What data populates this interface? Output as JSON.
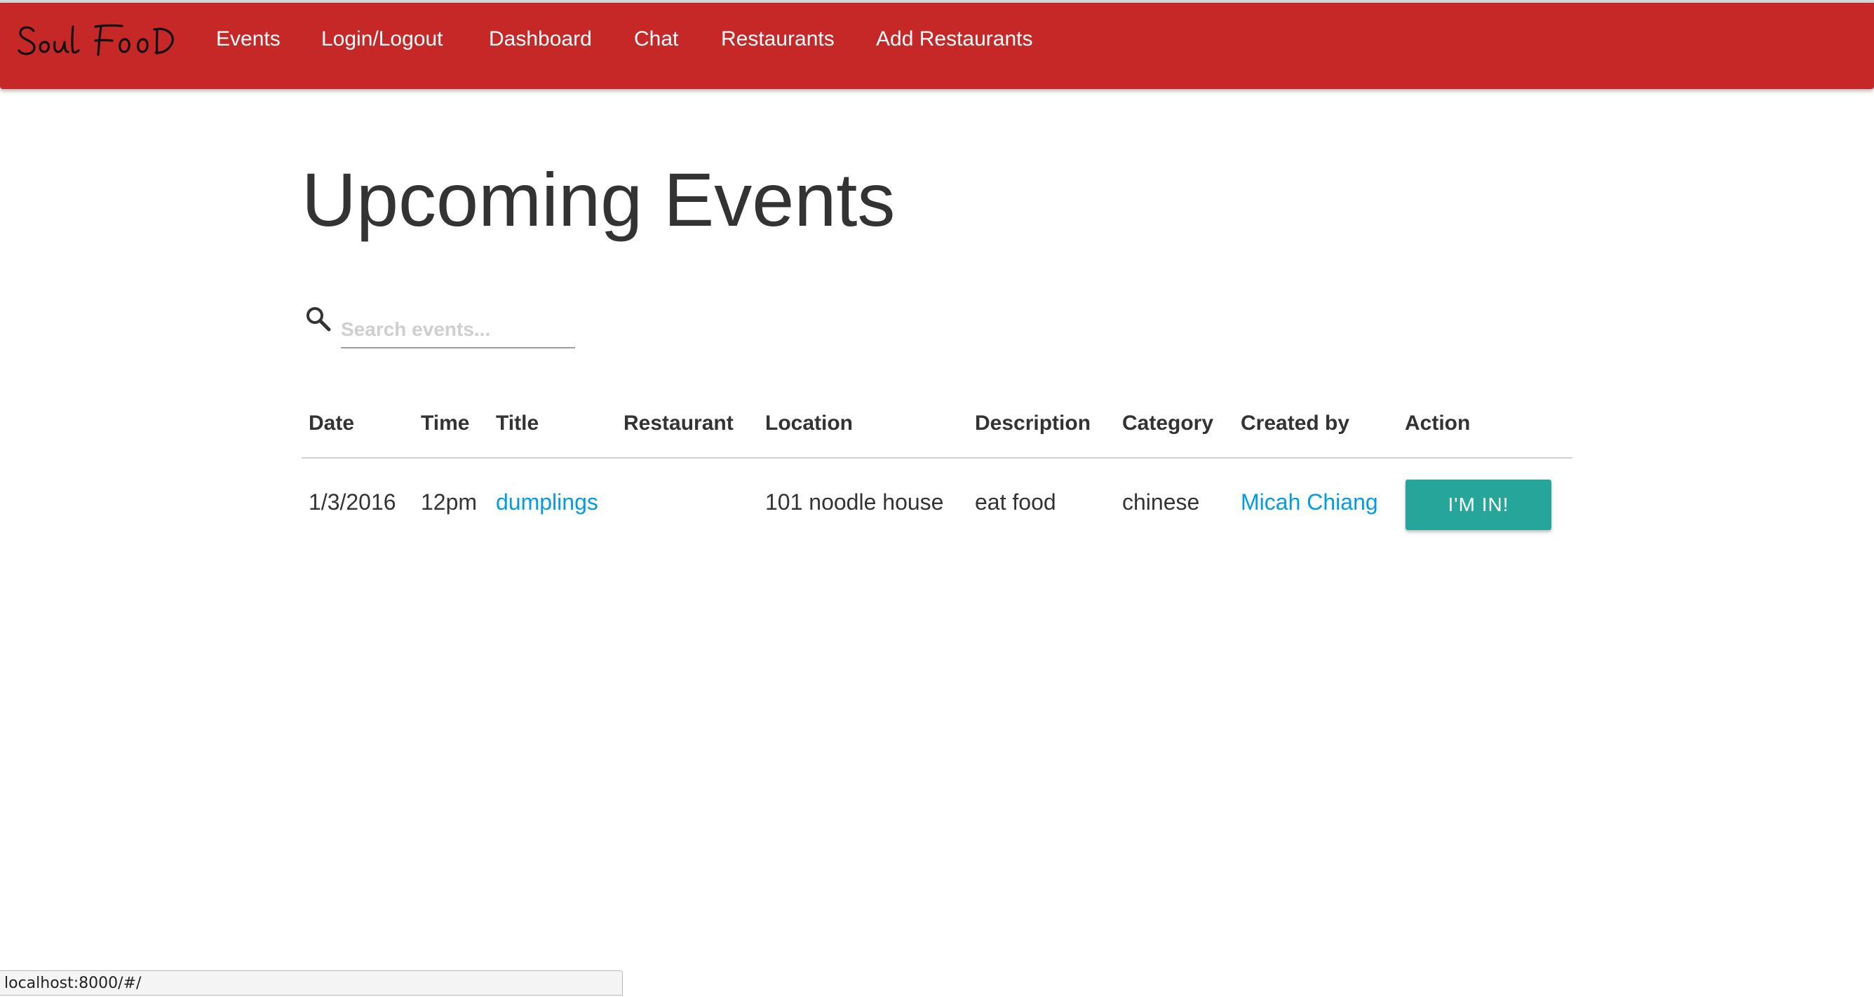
{
  "brand": {
    "name": "Soul Food",
    "color": "#000000"
  },
  "nav": {
    "background": "#c62828",
    "items": [
      {
        "label": "Events"
      },
      {
        "label": "Login/Logout"
      },
      {
        "label": "Dashboard"
      },
      {
        "label": "Chat"
      },
      {
        "label": "Restaurants"
      },
      {
        "label": "Add Restaurants"
      }
    ]
  },
  "page": {
    "title": "Upcoming Events"
  },
  "search": {
    "icon": "search-icon",
    "placeholder": "Search events...",
    "value": ""
  },
  "table": {
    "headers": [
      "Date",
      "Time",
      "Title",
      "Restaurant",
      "Location",
      "Description",
      "Category",
      "Created by",
      "Action"
    ],
    "rows": [
      {
        "date": "1/3/2016",
        "time": "12pm",
        "title": "dumplings",
        "restaurant": "",
        "location": "101 noodle house",
        "description": "eat food",
        "category": "chinese",
        "created_by": "Micah Chiang",
        "action_label": "I'M IN!"
      }
    ],
    "link_color": "#039be5",
    "action_color": "#26a69a"
  },
  "status_bar": {
    "url": "localhost:8000/#/"
  }
}
